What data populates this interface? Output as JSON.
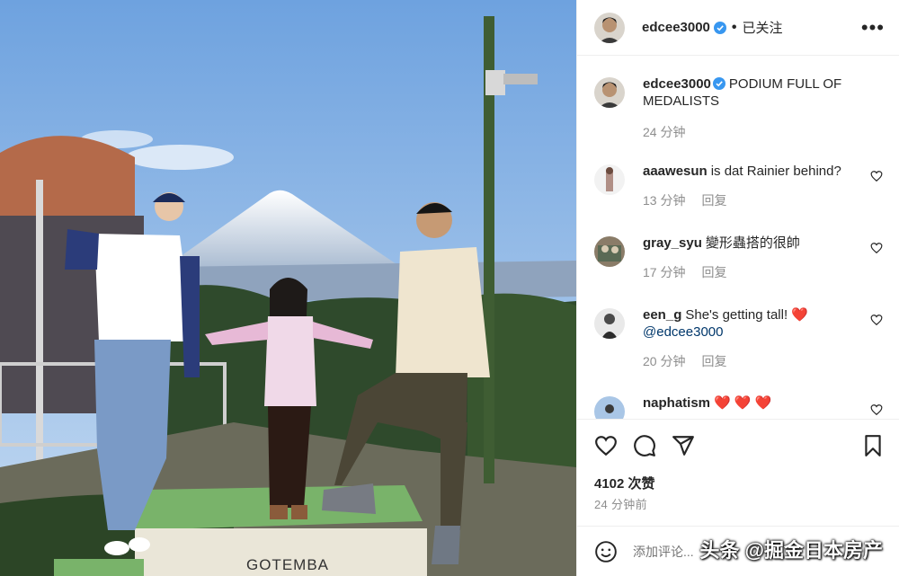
{
  "post": {
    "username": "edcee3000",
    "follow_status": "已关注",
    "more_icon": "more-horizontal-icon",
    "caption": "PODIUM FULL OF MEDALISTS",
    "caption_time": "24 分钟"
  },
  "photo": {
    "podium_text": "GOTEMBA"
  },
  "comments": [
    {
      "username": "aaawesun",
      "text": "is dat Rainier behind?",
      "time": "13 分钟",
      "reply": "回复"
    },
    {
      "username": "gray_syu",
      "text": "變形蟲搭的很帥",
      "time": "17 分钟",
      "reply": "回复"
    },
    {
      "username": "een_g",
      "text": "She's getting tall!",
      "emoji": "❤️",
      "mention": "@edcee3000",
      "time": "20 分钟",
      "reply": "回复"
    },
    {
      "username": "naphatism",
      "text": "❤️ ❤️ ❤️"
    }
  ],
  "actions": {
    "likes": "4102 次赞",
    "time": "24 分钟前"
  },
  "add_comment": {
    "placeholder": "添加评论..."
  },
  "watermark": "头条 @掘金日本房产",
  "colors": {
    "verified": "#3897f0",
    "heart": "#ed4956",
    "link": "#00376b",
    "muted": "#8e8e8e"
  }
}
